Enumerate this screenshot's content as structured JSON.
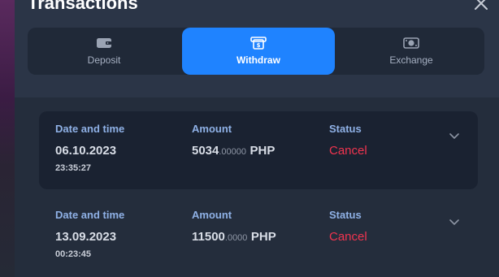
{
  "modal": {
    "title": "Transactions"
  },
  "tabs": [
    {
      "label": "Deposit",
      "icon": "wallet-icon",
      "active": false
    },
    {
      "label": "Withdraw",
      "icon": "cash-withdraw-icon",
      "active": true
    },
    {
      "label": "Exchange",
      "icon": "currency-exchange-icon",
      "active": false
    }
  ],
  "columns": {
    "date": "Date and time",
    "amount": "Amount",
    "status": "Status"
  },
  "transactions": [
    {
      "date": "06.10.2023",
      "time": "23:35:27",
      "amount_int": "5034",
      "amount_dec": ".00000",
      "currency": "PHP",
      "status": "Cancel"
    },
    {
      "date": "13.09.2023",
      "time": "00:23:45",
      "amount_int": "11500",
      "amount_dec": ".0000",
      "currency": "PHP",
      "status": "Cancel"
    }
  ],
  "colors": {
    "accent": "#1f83ff",
    "status_cancel": "#f0344f",
    "label": "#8fb1e6"
  }
}
